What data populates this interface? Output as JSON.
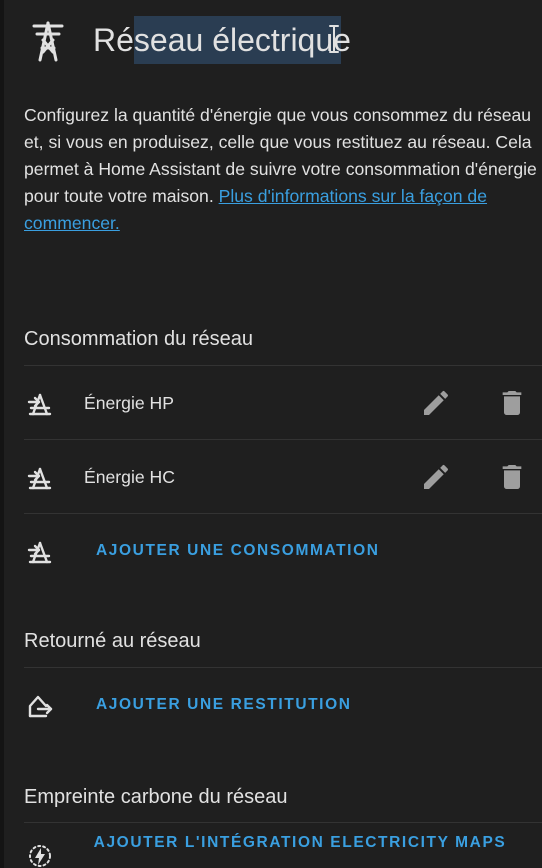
{
  "header": {
    "title": "Réseau électrique",
    "icon": "transmission-tower-icon"
  },
  "intro": {
    "text": "Configurez la quantité d'énergie que vous consommez du réseau et, si vous en produisez, celle que vous restituez au réseau. Cela permet à Home Assistant de suivre votre consommation d'énergie pour toute votre maison. ",
    "link_text": "Plus d'informations sur la façon de commencer."
  },
  "consumption": {
    "title": "Consommation du réseau",
    "items": [
      {
        "label": "Énergie HP",
        "icon": "transmission-tower-import-icon"
      },
      {
        "label": "Énergie HC",
        "icon": "transmission-tower-import-icon"
      }
    ],
    "add_label": "AJOUTER UNE CONSOMMATION"
  },
  "return": {
    "title": "Retourné au réseau",
    "add_label": "AJOUTER UNE RESTITUTION"
  },
  "carbon": {
    "title": "Empreinte carbone du réseau",
    "add_label": "AJOUTER L'INTÉGRATION ELECTRICITY MAPS"
  },
  "colors": {
    "background": "#1f1f1f",
    "text": "#e1e1e1",
    "accent": "#3a9fe0",
    "icon": "#9e9e9e"
  }
}
